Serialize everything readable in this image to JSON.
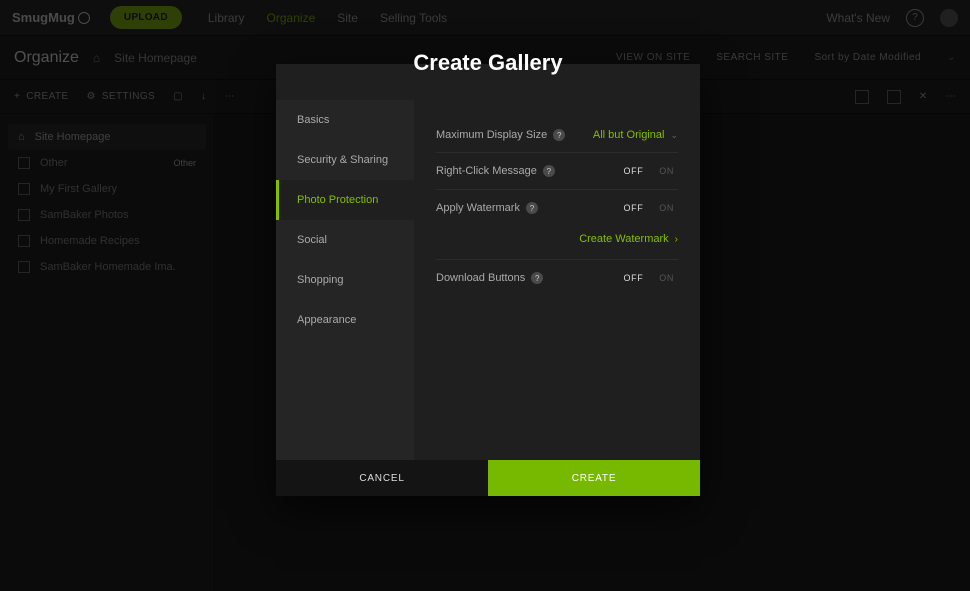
{
  "topbar": {
    "brand": "SmugMug",
    "upload_label": "UPLOAD",
    "nav": {
      "library": "Library",
      "organize": "Organize",
      "site": "Site",
      "selling": "Selling Tools"
    },
    "whats_new": "What's New"
  },
  "subbar": {
    "title": "Organize",
    "breadcrumb": "Site Homepage",
    "right": {
      "view": "VIEW ON SITE",
      "search": "SEARCH SITE",
      "sort": "Sort by Date Modified"
    }
  },
  "toolbar": {
    "create": "CREATE",
    "settings": "SETTINGS",
    "select_all": "SELECT ALL"
  },
  "sidebar_bg": {
    "items": [
      {
        "label": "Site Homepage",
        "selected": true
      },
      {
        "label": "Other",
        "tag": "Other"
      },
      {
        "label": "My First Gallery"
      },
      {
        "label": "SamBaker Photos"
      },
      {
        "label": "Homemade Recipes"
      },
      {
        "label": "SamBaker Homemade Ima."
      }
    ]
  },
  "modal": {
    "title": "Create Gallery",
    "tabs": {
      "basics": "Basics",
      "security": "Security & Sharing",
      "photo": "Photo Protection",
      "social": "Social",
      "shopping": "Shopping",
      "appearance": "Appearance"
    },
    "rows": {
      "max_display": {
        "label": "Maximum Display Size",
        "value": "All but Original"
      },
      "right_click": {
        "label": "Right-Click Message"
      },
      "watermark": {
        "label": "Apply Watermark"
      },
      "create_watermark": "Create Watermark",
      "download": {
        "label": "Download Buttons"
      }
    },
    "toggle": {
      "off": "OFF",
      "on": "ON"
    },
    "actions": {
      "cancel": "CANCEL",
      "create": "CREATE"
    }
  }
}
